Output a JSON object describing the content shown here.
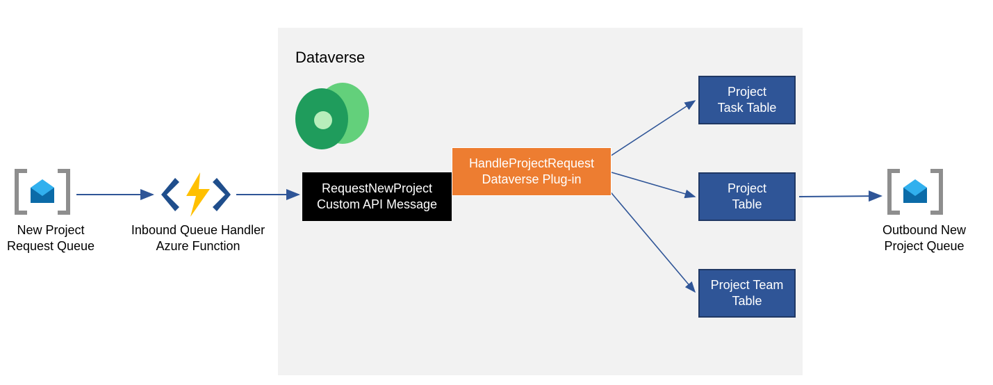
{
  "left_queue": {
    "label": "New Project\nRequest Queue"
  },
  "azure_function": {
    "label": "Inbound Queue Handler\nAzure Function"
  },
  "dataverse": {
    "title": "Dataverse",
    "custom_api": {
      "label": "RequestNewProject\nCustom API Message"
    },
    "plugin": {
      "label": "HandleProjectRequest\nDataverse Plug-in"
    },
    "tables": {
      "task": {
        "label": "Project\nTask Table"
      },
      "project": {
        "label": "Project\nTable"
      },
      "team": {
        "label": "Project Team\nTable"
      }
    }
  },
  "right_queue": {
    "label": "Outbound New\nProject Queue"
  },
  "colors": {
    "arrow": "#2f5597",
    "blue_fill": "#2f5597",
    "orange_fill": "#ed7d31",
    "panel": "#f2f2f2",
    "bracket": "#8e8e8e",
    "message_dark": "#0b6ba8",
    "message_light": "#31b0ee",
    "fn_chevron": "#1f4e8c",
    "fn_bolt": "#ffc000",
    "dv_green1": "#1f9c5c",
    "dv_green2": "#63d07b",
    "dv_green3": "#b7eebb"
  }
}
